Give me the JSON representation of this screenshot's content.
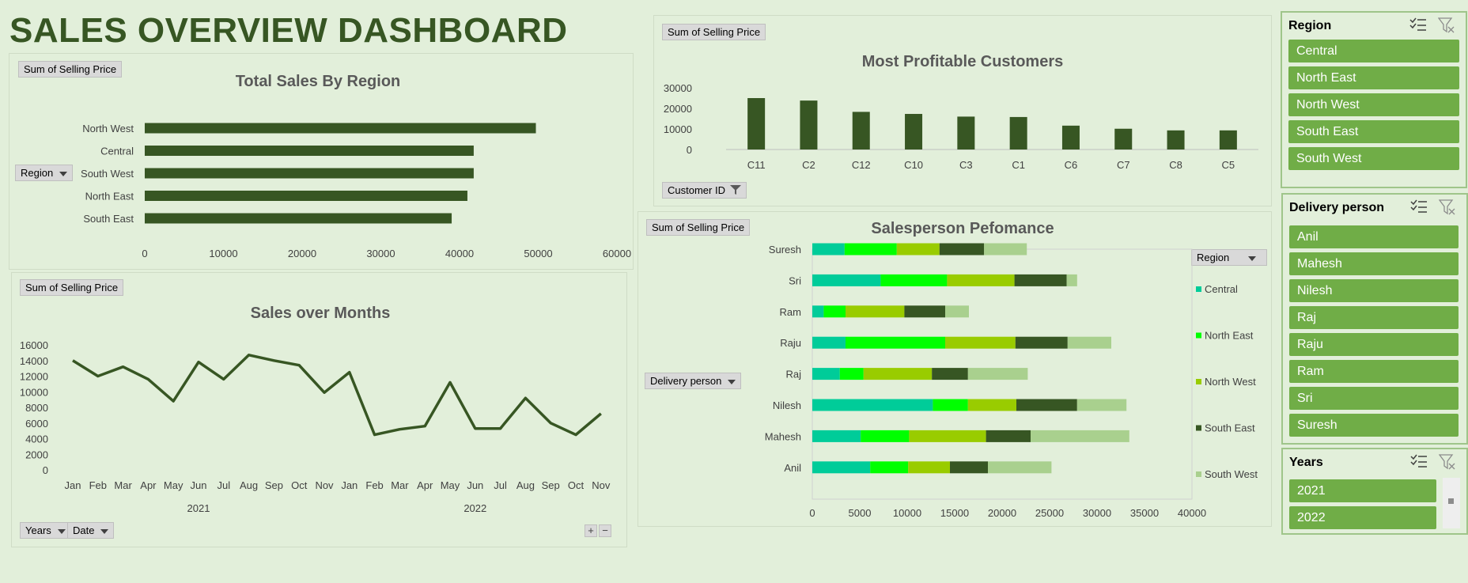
{
  "dashboard_title": "SALES OVERVIEW DASHBOARD",
  "colors": {
    "dark_green": "#375623",
    "accent": "#70ad47",
    "bg": "#e2efda"
  },
  "region_chart": {
    "field_button": "Sum of Selling Price",
    "axis_button": "Region",
    "chart_data": {
      "type": "bar",
      "orientation": "horizontal",
      "title": "Total Sales By Region",
      "categories": [
        "North West",
        "Central",
        "South West",
        "North East",
        "South East"
      ],
      "values": [
        49700,
        41800,
        41800,
        41000,
        39000
      ],
      "xlim": [
        0,
        60000
      ],
      "xticks": [
        "0",
        "10000",
        "20000",
        "30000",
        "40000",
        "50000",
        "60000"
      ],
      "color": "#375623"
    }
  },
  "months_chart": {
    "field_button": "Sum of Selling Price",
    "filter_buttons": [
      "Years",
      "Date"
    ],
    "chart_data": {
      "type": "line",
      "title": "Sales over Months",
      "categories": [
        "Jan",
        "Feb",
        "Mar",
        "Apr",
        "May",
        "Jun",
        "Jul",
        "Aug",
        "Sep",
        "Oct",
        "Nov",
        "Jan",
        "Feb",
        "Mar",
        "Apr",
        "May",
        "Jun",
        "Jul",
        "Aug",
        "Sep",
        "Oct",
        "Nov"
      ],
      "groups": [
        {
          "label": "2021",
          "count": 11
        },
        {
          "label": "2022",
          "count": 11
        }
      ],
      "values": [
        14000,
        12000,
        13200,
        11600,
        8800,
        13800,
        11600,
        14700,
        14000,
        13400,
        9900,
        12500,
        4500,
        5200,
        5600,
        11200,
        5300,
        5300,
        9200,
        6000,
        4500,
        7200
      ],
      "ylim": [
        0,
        16000
      ],
      "yticks": [
        "0",
        "2000",
        "4000",
        "6000",
        "8000",
        "10000",
        "12000",
        "14000",
        "16000"
      ],
      "color": "#375623"
    }
  },
  "customers_chart": {
    "field_button": "Sum of Selling Price",
    "axis_button": "Customer ID",
    "chart_data": {
      "type": "bar",
      "title": "Most Profitable Customers",
      "categories": [
        "C11",
        "C2",
        "C12",
        "C10",
        "C3",
        "C1",
        "C6",
        "C7",
        "C8",
        "C5"
      ],
      "values": [
        25000,
        23800,
        18300,
        17300,
        16000,
        15800,
        11600,
        10100,
        9300,
        9300
      ],
      "ylim": [
        0,
        30000
      ],
      "yticks": [
        "0",
        "10000",
        "20000",
        "30000"
      ],
      "color": "#375623"
    }
  },
  "salesperson_chart": {
    "field_button": "Sum of Selling Price",
    "axis_button": "Delivery person",
    "legend_button": "Region",
    "chart_data": {
      "type": "bar",
      "orientation": "horizontal",
      "stacked": true,
      "title": "Salesperson Pefomance",
      "categories": [
        "Suresh",
        "Sri",
        "Ram",
        "Raju",
        "Raj",
        "Nilesh",
        "Mahesh",
        "Anil"
      ],
      "series": [
        {
          "name": "Central",
          "color": "#00cc99",
          "values": [
            3400,
            7200,
            1200,
            3500,
            2900,
            12700,
            5100,
            6100
          ]
        },
        {
          "name": "North East",
          "color": "#00ff00",
          "values": [
            5500,
            7000,
            2300,
            10500,
            2500,
            3700,
            5100,
            4000
          ]
        },
        {
          "name": "North West",
          "color": "#99cc00",
          "values": [
            4500,
            7100,
            6200,
            7400,
            7200,
            5100,
            8100,
            4400
          ]
        },
        {
          "name": "South East",
          "color": "#375623",
          "values": [
            4700,
            5500,
            4300,
            5500,
            3800,
            6400,
            4700,
            4000
          ]
        },
        {
          "name": "South West",
          "color": "#a9d08e",
          "values": [
            4500,
            1100,
            2500,
            4600,
            6300,
            5200,
            10400,
            6700
          ]
        }
      ],
      "xlim": [
        0,
        40000
      ],
      "xticks": [
        "0",
        "5000",
        "10000",
        "15000",
        "20000",
        "25000",
        "30000",
        "35000",
        "40000"
      ],
      "legend_position": "right"
    }
  },
  "slicers": {
    "region": {
      "title": "Region",
      "items": [
        "Central",
        "North East",
        "North West",
        "South East",
        "South West"
      ]
    },
    "delivery": {
      "title": "Delivery person",
      "items": [
        "Anil",
        "Mahesh",
        "Nilesh",
        "Raj",
        "Raju",
        "Ram",
        "Sri",
        "Suresh"
      ]
    },
    "years": {
      "title": "Years",
      "items": [
        "2021",
        "2022"
      ]
    }
  },
  "pm_buttons": [
    "+",
    "−"
  ]
}
